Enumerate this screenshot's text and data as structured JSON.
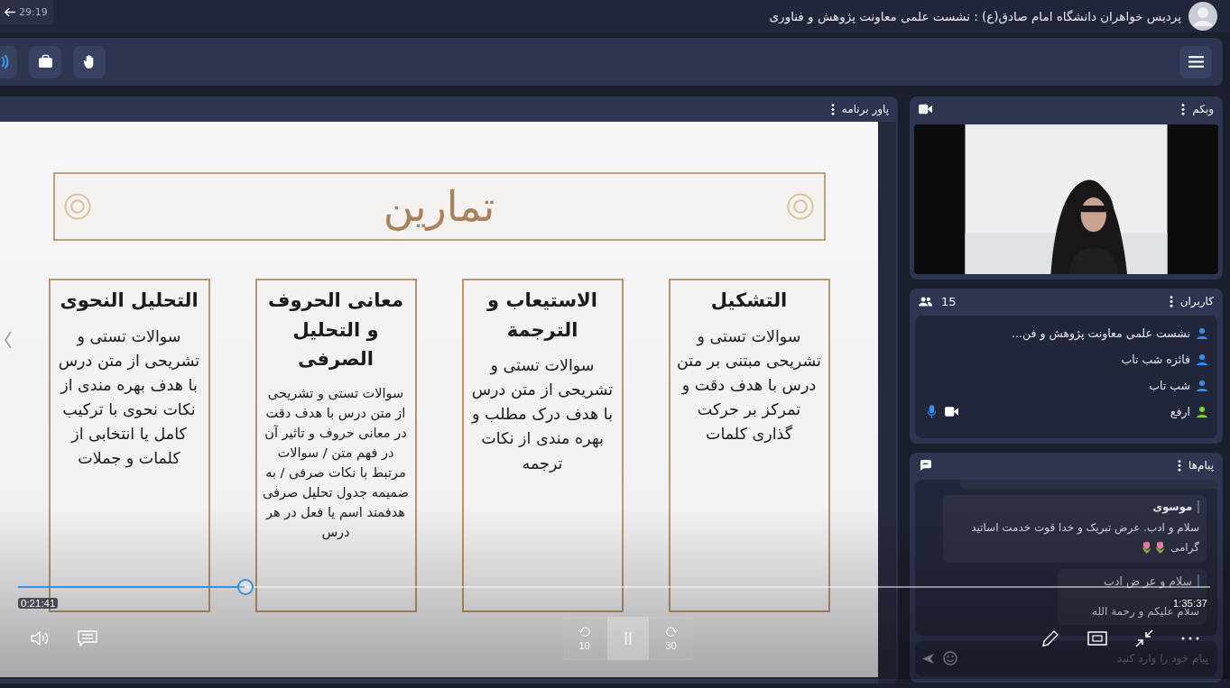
{
  "header": {
    "title": "پردیس خواهران دانشگاه امام صادق(ع) : نشست علمی معاونت پژوهش و فناوری",
    "timer": "29:19"
  },
  "presentation_panel": {
    "title": "پاور برنامه",
    "slide": {
      "title": "تمارين",
      "cards": [
        {
          "heading": "التشکیل",
          "body": "سوالات تستی و تشریحی مبتنی بر متن درس با هدف دقت و تمرکز بر حرکت گذاری کلمات",
          "dense": false
        },
        {
          "heading": "الاستیعاب و الترجمة",
          "body": "سوالات تستی و تشریحی از متن درس با هدف درک مطلب و بهره مندی از نکات ترجمه",
          "dense": false
        },
        {
          "heading": "معانی الحروف و التحلیل الصرفی",
          "body": "سوالات تستی و تشریحی از متن درس با هدف دقت در معانی حروف و تاثیر آن در فهم متن / سوالات مرتبط با نکات صرفی / به ضمیمه جدول تحلیل صرفی هدفمند اسم یا فعل در هر درس",
          "dense": true
        },
        {
          "heading": "التحلیل النحوی",
          "body": "سوالات تستی و تشریحی از متن درس با هدف بهره مندی از نکات نحوی با ترکیب کامل یا انتخابی از کلمات و جملات",
          "dense": false
        }
      ]
    }
  },
  "player": {
    "elapsed": "0:21:41",
    "duration": "1:35:37",
    "level": 0.19,
    "playing": true,
    "rewind_seconds": "10",
    "forward_seconds": "30"
  },
  "webcam_panel": {
    "title": "وبکم"
  },
  "users_panel": {
    "title": "کاربران",
    "count": "15",
    "users": [
      {
        "name": "نشست علمی معاونت پژوهش و فن...",
        "color": "#2f8ff2",
        "mic": false,
        "camera": false
      },
      {
        "name": "فائزه شب تاب",
        "color": "#2f8ff2",
        "mic": false,
        "camera": false
      },
      {
        "name": "شب تاب",
        "color": "#2f8ff2",
        "mic": false,
        "camera": false
      },
      {
        "name": "ارفع",
        "color": "#7fd41c",
        "mic": true,
        "camera": true
      }
    ]
  },
  "messages_panel": {
    "title": "پیام‌ها",
    "messages": [
      {
        "sender": "موسوی",
        "text": "سلام و ادب. عرض تبریک و خدا قوت خدمت اساتید گرامی 🌷🌷"
      },
      {
        "sender": "سلام و عر ض ادب",
        "text": "سلام علیکم و رحمة الله"
      }
    ],
    "input": {
      "placeholder": "پیام خود را وارد کنید"
    }
  }
}
